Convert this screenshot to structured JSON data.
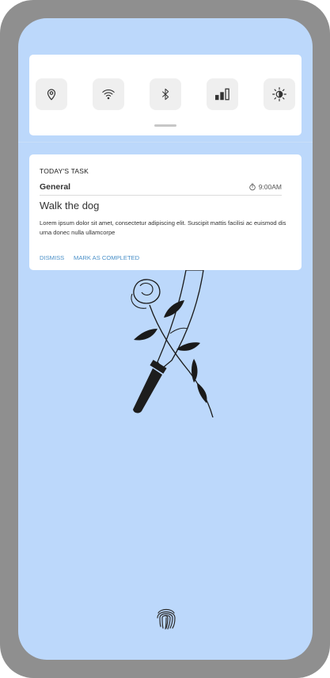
{
  "quick_settings": {
    "tiles": [
      {
        "icon": "location-pin-icon"
      },
      {
        "icon": "wifi-icon"
      },
      {
        "icon": "bluetooth-icon"
      },
      {
        "icon": "mobile-signal-icon"
      },
      {
        "icon": "brightness-icon"
      }
    ]
  },
  "notification": {
    "heading": "TODAY'S TASK",
    "category": "General",
    "time": "9:00AM",
    "title": "Walk the dog",
    "body": "Lorem ipsum dolor sit amet, consectetur adipiscing elit. Suscipit mattis facilisi ac euismod dis urna donec nulla ullamcorpe",
    "actions": {
      "dismiss": "DISMISS",
      "complete": "MARK AS COMPLETED"
    }
  },
  "colors": {
    "screen_bg": "#bcd8fb",
    "frame": "#8f8f8f",
    "action_link": "#4a90c8"
  }
}
